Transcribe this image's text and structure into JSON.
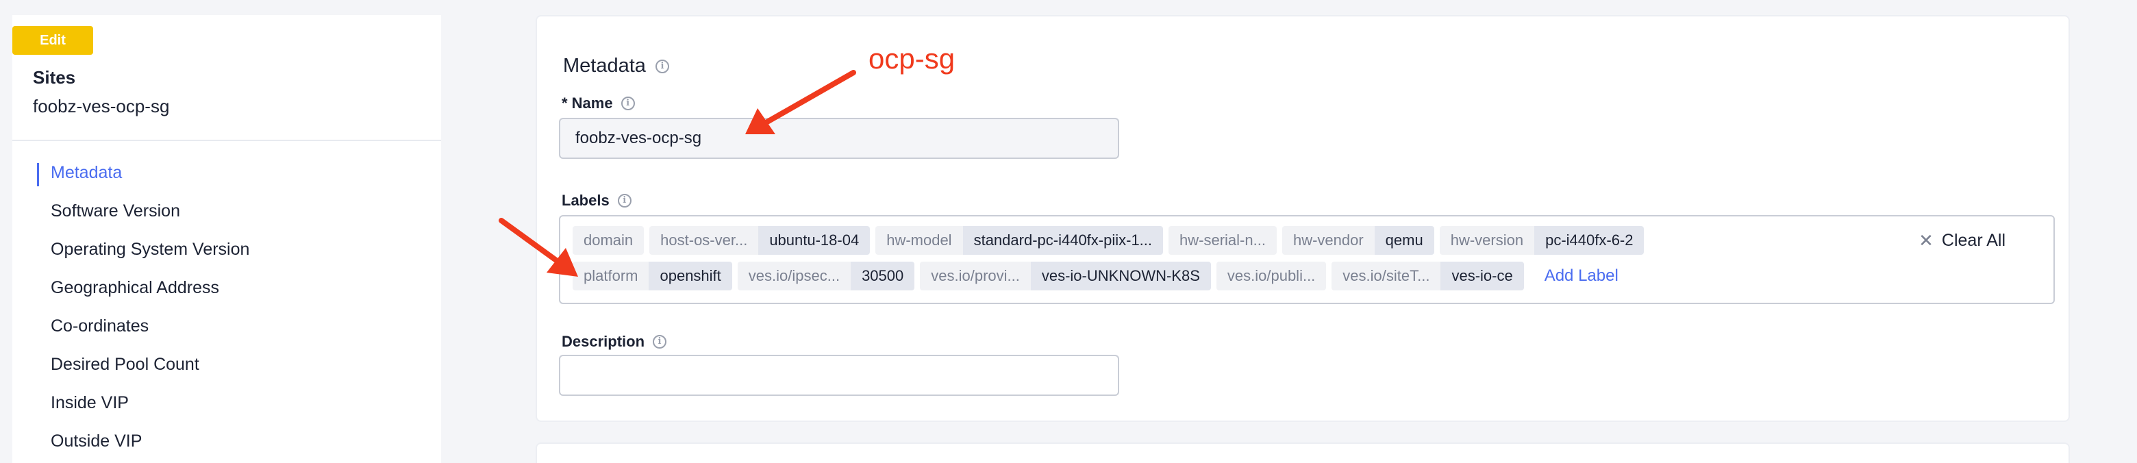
{
  "sidebar": {
    "edit_badge": "Edit",
    "title": "Sites",
    "site_name": "foobz-ves-ocp-sg",
    "items": [
      {
        "label": "Metadata",
        "active": true
      },
      {
        "label": "Software Version"
      },
      {
        "label": "Operating System Version"
      },
      {
        "label": "Geographical Address"
      },
      {
        "label": "Co-ordinates"
      },
      {
        "label": "Desired Pool Count"
      },
      {
        "label": "Inside VIP"
      },
      {
        "label": "Outside VIP"
      }
    ]
  },
  "metadata": {
    "section_title": "Metadata",
    "name_label": "* Name",
    "name_value": "foobz-ves-ocp-sg",
    "labels_label": "Labels",
    "labels_row1": [
      {
        "key": "domain",
        "value": ""
      },
      {
        "key": "host-os-ver...",
        "value": "ubuntu-18-04"
      },
      {
        "key": "hw-model",
        "value": "standard-pc-i440fx-piix-1..."
      },
      {
        "key": "hw-serial-n...",
        "value": ""
      },
      {
        "key": "hw-vendor",
        "value": "qemu"
      },
      {
        "key": "hw-version",
        "value": "pc-i440fx-6-2"
      }
    ],
    "labels_row2": [
      {
        "key": "platform",
        "value": "openshift"
      },
      {
        "key": "ves.io/ipsec...",
        "value": "30500"
      },
      {
        "key": "ves.io/provi...",
        "value": "ves-io-UNKNOWN-K8S"
      },
      {
        "key": "ves.io/publi...",
        "value": ""
      },
      {
        "key": "ves.io/siteT...",
        "value": "ves-io-ce"
      }
    ],
    "add_label": "Add Label",
    "clear_all": "Clear All",
    "description_label": "Description",
    "description_value": ""
  },
  "annotation": {
    "text": "ocp-sg",
    "color": "#f03a1d"
  },
  "colors": {
    "accent": "#4a6cf0",
    "edit_badge": "#f5c400"
  }
}
